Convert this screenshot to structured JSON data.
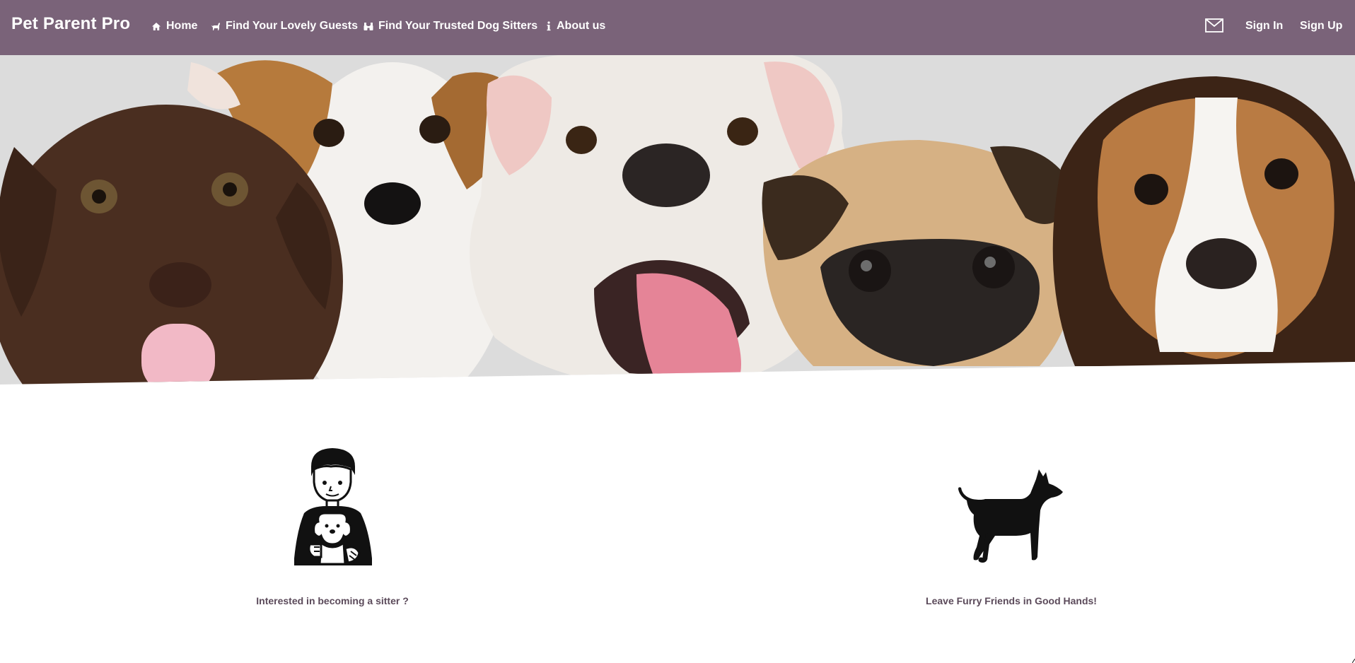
{
  "brand": {
    "name": "Pet Parent Pro"
  },
  "nav": {
    "items": [
      {
        "label": "Home",
        "icon": "home-icon"
      },
      {
        "label": "Find Your Lovely Guests",
        "icon": "dog-icon"
      },
      {
        "label": "Find Your Trusted Dog Sitters",
        "icon": "binoculars-icon"
      },
      {
        "label": "About us",
        "icon": "info-icon"
      }
    ],
    "mail_icon": "envelope-icon",
    "sign_in": "Sign In",
    "sign_up": "Sign Up"
  },
  "hero": {
    "image": "five-puppies-banner"
  },
  "features": [
    {
      "label": "Interested in becoming a sitter ?",
      "icon": "person-holding-puppy-icon"
    },
    {
      "label": "Leave Furry Friends in Good Hands!",
      "icon": "dog-silhouette-icon"
    }
  ],
  "colors": {
    "navbar": "#7a6379",
    "nav_text": "#ffffff",
    "feature_text": "#5b4a5a",
    "hero_background": "#dcdcdc"
  }
}
